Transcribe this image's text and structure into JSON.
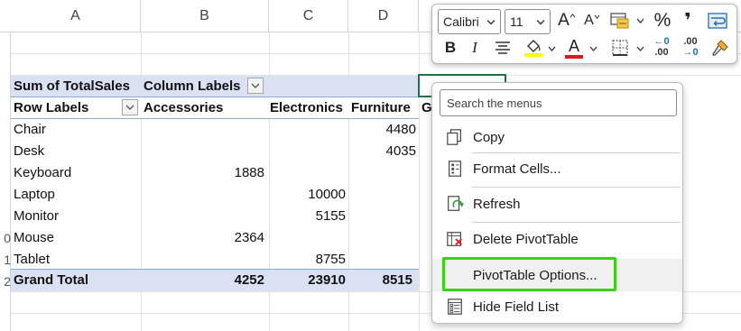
{
  "grid": {
    "columns": [
      "A",
      "B",
      "C",
      "D"
    ],
    "row_numbers": [
      "0",
      "1",
      "2"
    ]
  },
  "pivot": {
    "value_header": "Sum of TotalSales",
    "column_labels": "Column Labels",
    "row_labels": "Row Labels",
    "col_headers": [
      "Accessories",
      "Electronics",
      "Furniture",
      "G"
    ],
    "rows": [
      {
        "label": "Chair",
        "accessories": "",
        "electronics": "",
        "furniture": "4480"
      },
      {
        "label": "Desk",
        "accessories": "",
        "electronics": "",
        "furniture": "4035"
      },
      {
        "label": "Keyboard",
        "accessories": "1888",
        "electronics": "",
        "furniture": ""
      },
      {
        "label": "Laptop",
        "accessories": "",
        "electronics": "10000",
        "furniture": ""
      },
      {
        "label": "Monitor",
        "accessories": "",
        "electronics": "5155",
        "furniture": ""
      },
      {
        "label": "Mouse",
        "accessories": "2364",
        "electronics": "",
        "furniture": ""
      },
      {
        "label": "Tablet",
        "accessories": "",
        "electronics": "8755",
        "furniture": ""
      }
    ],
    "grand_total": {
      "label": "Grand Total",
      "accessories": "4252",
      "electronics": "23910",
      "furniture": "8515"
    }
  },
  "mini_toolbar": {
    "font_name": "Calibri",
    "font_size": "11",
    "grow_font": "A",
    "shrink_font": "A",
    "percent": "%",
    "comma": "❜",
    "bold": "B",
    "italic": "I",
    "font_color_letter": "A",
    "fill_color": "#ffff00",
    "font_color": "#e81123",
    "inc_decimal_top": "←0",
    "inc_decimal_bottom": ".00",
    "dec_decimal_top": ".00",
    "dec_decimal_bottom": "→0"
  },
  "context_menu": {
    "search_placeholder": "Search the menus",
    "items": [
      {
        "label": "Copy",
        "icon": "copy-icon"
      },
      {
        "label": "Format Cells...",
        "icon": "format-cells-icon"
      },
      {
        "label": "Refresh",
        "icon": "refresh-icon"
      },
      {
        "label": "Delete PivotTable",
        "icon": "delete-pivottable-icon"
      },
      {
        "label": "PivotTable Options...",
        "icon": ""
      },
      {
        "label": "Hide Field List",
        "icon": "field-list-icon"
      }
    ],
    "highlight_color": "#3cd019"
  }
}
